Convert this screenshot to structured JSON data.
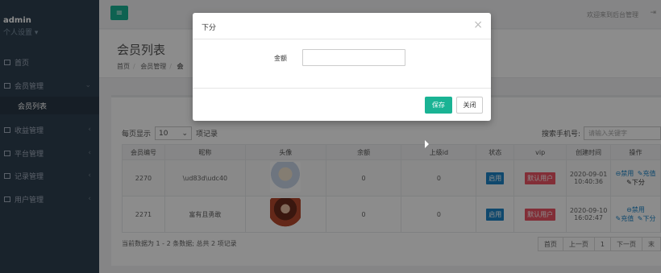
{
  "sidebar": {
    "user_name": "admin",
    "user_settings": "个人设置 ▾",
    "items": [
      {
        "label": "首页",
        "chevron": ""
      },
      {
        "label": "会员管理",
        "chevron": "⌄"
      },
      {
        "label": "收益管理",
        "chevron": "‹"
      },
      {
        "label": "平台管理",
        "chevron": "‹"
      },
      {
        "label": "记录管理",
        "chevron": "‹"
      },
      {
        "label": "用户管理",
        "chevron": "‹"
      }
    ],
    "sub_item": "会员列表"
  },
  "topbar": {
    "menu_icon": "≡",
    "welcome": "欢迎来到后台管理",
    "logout_icon": "⇥"
  },
  "heading": {
    "title": "会员列表",
    "breadcrumb": [
      "首页",
      "会员管理",
      "会"
    ]
  },
  "table_controls": {
    "per_page_label": "每页显示",
    "per_page_value": "10",
    "per_page_suffix": "项记录",
    "search_label": "搜索手机号:",
    "search_placeholder": "请输入关键字"
  },
  "table": {
    "headers": [
      "会员编号",
      "昵称",
      "头像",
      "余额",
      "上级id",
      "状态",
      "vip",
      "创建时间",
      "操作"
    ],
    "rows": [
      {
        "id": "2270",
        "nickname": "\\ud83d\\udc40",
        "balance": "0",
        "parent_id": "0",
        "status": "启用",
        "vip": "默认用户",
        "created_date": "2020-09-01",
        "created_time": "10:40:36",
        "ops": [
          "禁用",
          "充值",
          "下分"
        ]
      },
      {
        "id": "2271",
        "nickname": "富有且勇敢",
        "balance": "0",
        "parent_id": "0",
        "status": "启用",
        "vip": "默认用户",
        "created_date": "2020-09-10",
        "created_time": "16:02:47",
        "ops": [
          "禁用",
          "充值",
          "下分"
        ]
      }
    ]
  },
  "footer": {
    "info": "当前数据为 1 - 2 条数据; 总共 2 项记录",
    "pager": [
      "首页",
      "上一页",
      "1",
      "下一页",
      "末"
    ]
  },
  "modal": {
    "title": "下分",
    "close_icon": "×",
    "field_label": "金额",
    "field_value": "",
    "save_label": "保存",
    "cancel_label": "关闭"
  },
  "colors": {
    "accent": "#1ab394",
    "sidebar_bg": "#2f4050",
    "badge_blue": "#1c84c6",
    "badge_red": "#ed5565"
  }
}
